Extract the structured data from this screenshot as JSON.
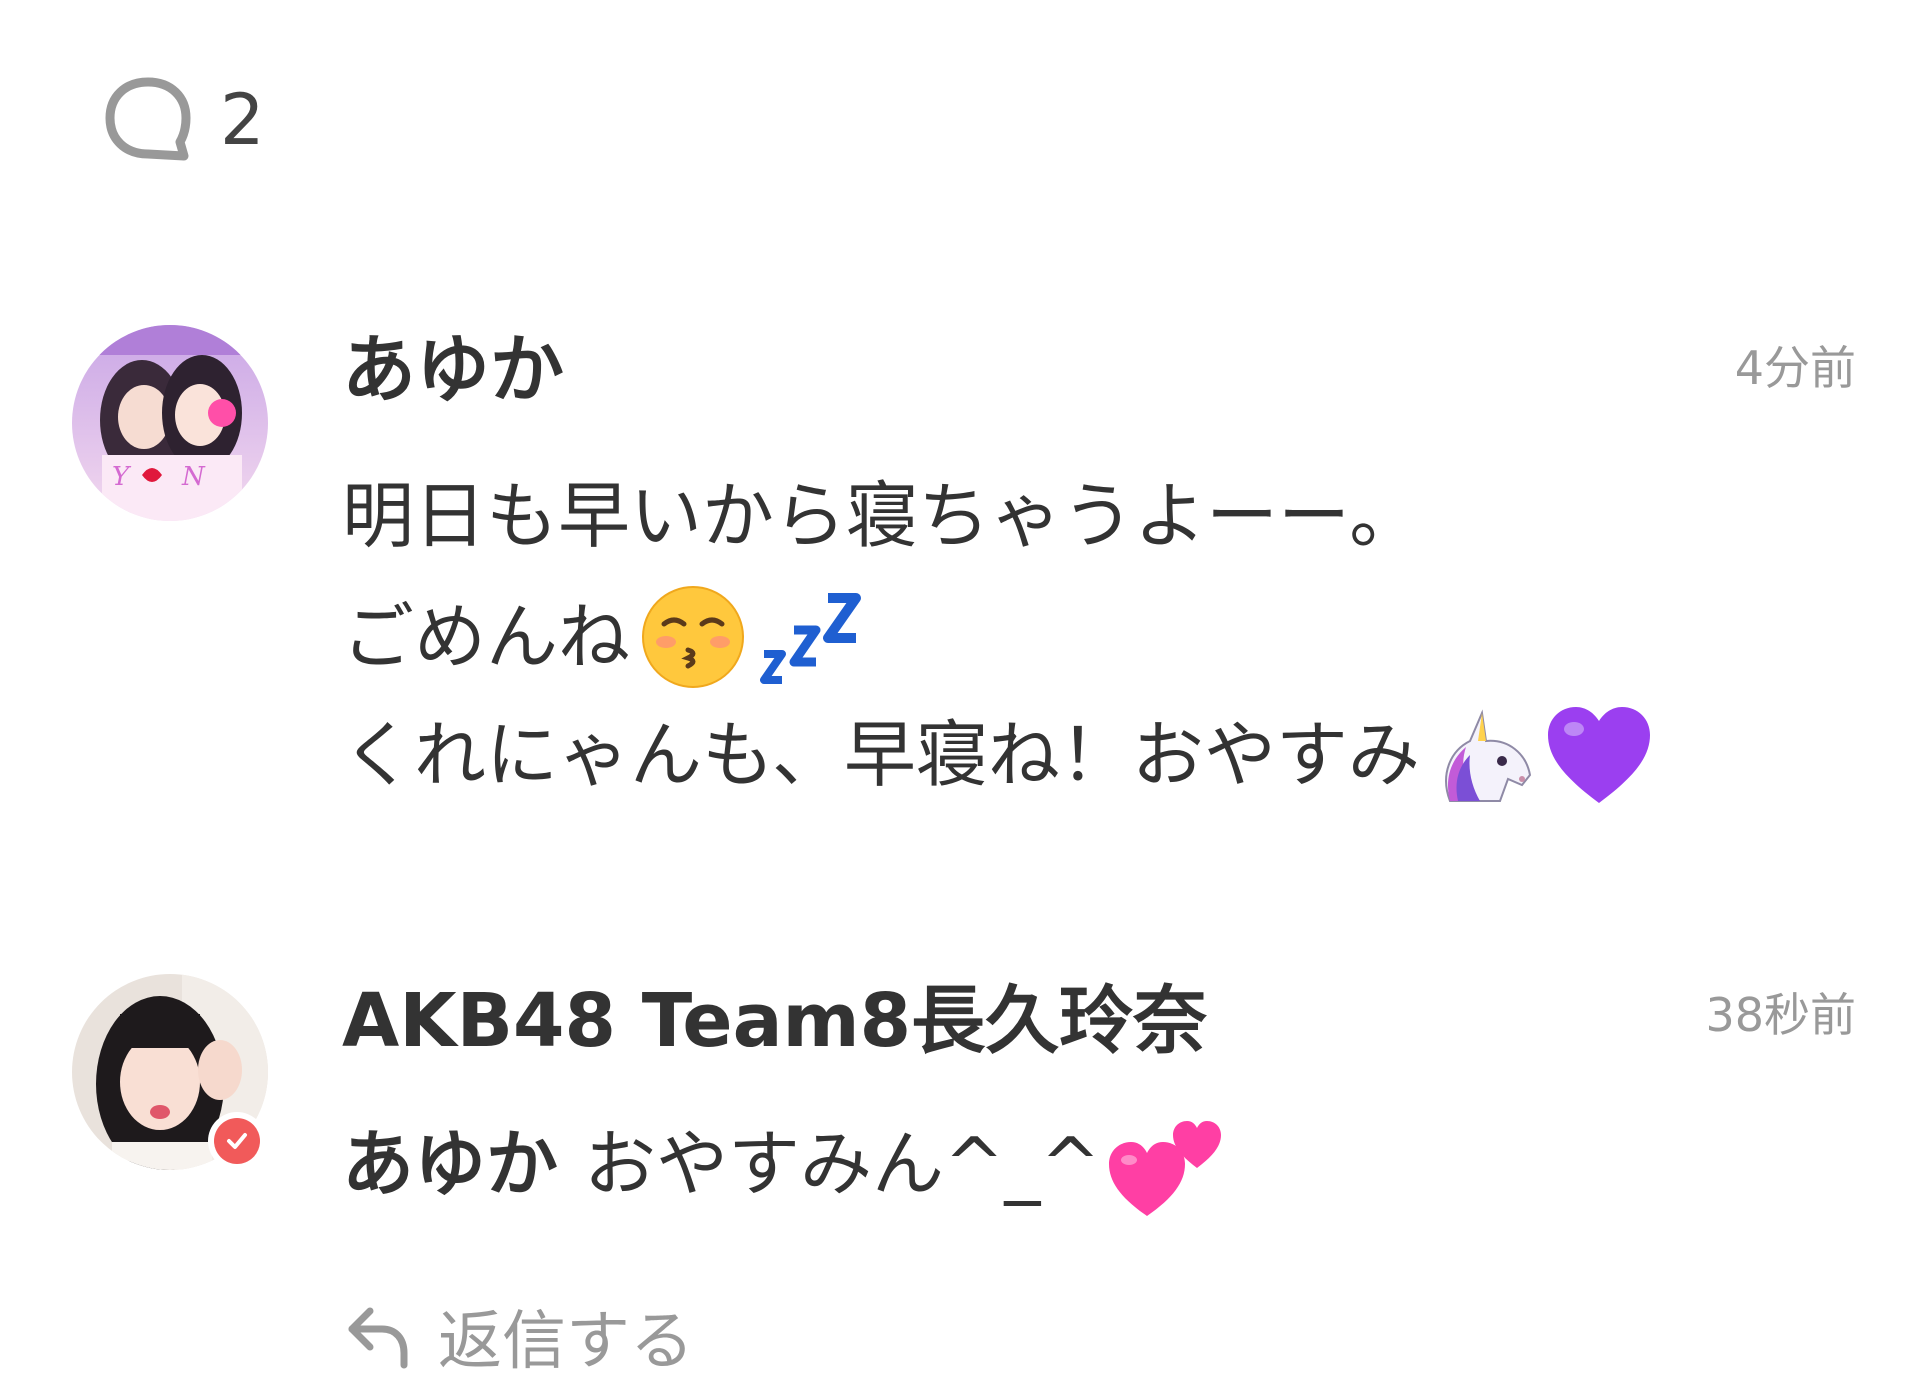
{
  "header": {
    "comment_icon": "speech-bubble-icon",
    "comment_count": "2"
  },
  "comments": [
    {
      "author": "あゆか",
      "time": "4分前",
      "lines": [
        "明日も早いから寝ちゃうよーー。",
        "ごめんね",
        "くれにゃんも、早寝ね！おやすみ"
      ],
      "emojis": [
        "kissing-face-emoji",
        "zzz-emoji",
        "unicorn-emoji",
        "purple-heart-emoji"
      ]
    },
    {
      "author": "AKB48 Team8長久玲奈",
      "time": "38秒前",
      "verified": true,
      "mention": "あゆか",
      "text": "おやすみん^_^",
      "emojis": [
        "two-hearts-emoji"
      ]
    }
  ],
  "reply": {
    "label": "返信する",
    "icon": "reply-arrow-icon"
  },
  "colors": {
    "text": "#333333",
    "muted": "#999999",
    "verified_badge": "#f15a5a",
    "zzz": "#1f5fd1",
    "purple_heart": "#9b3ff0",
    "pink_heart": "#ff3fa4"
  }
}
